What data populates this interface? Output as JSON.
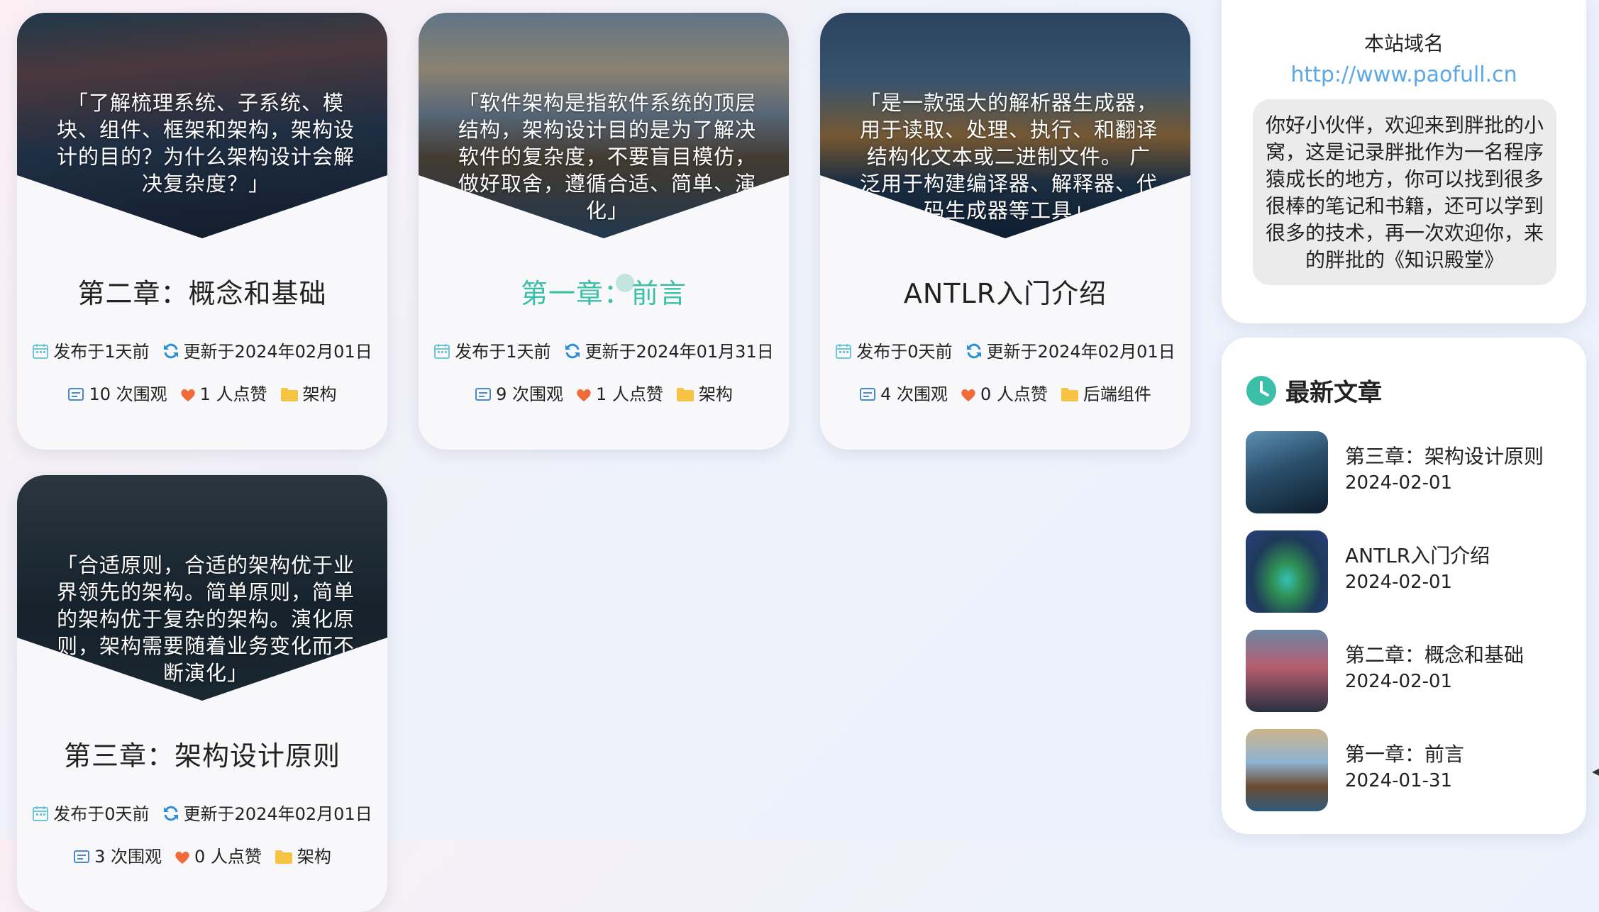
{
  "cards": [
    {
      "quote": "「了解梳理系统、子系统、模块、组件、框架和架构，架构设计的目的？为什么架构设计会解决复杂度？」",
      "title": "第二章：概念和基础",
      "published": "发布于1天前",
      "updated": "更新于2024年02月01日",
      "views": "10 次围观",
      "likes": "1 人点赞",
      "category": "架构"
    },
    {
      "quote": "「软件架构是指软件系统的顶层结构，架构设计目的是为了解决软件的复杂度，不要盲目模仿，做好取舍，遵循合适、简单、演化」",
      "title": "第一章：前言",
      "published": "发布于1天前",
      "updated": "更新于2024年01月31日",
      "views": "9 次围观",
      "likes": "1 人点赞",
      "category": "架构"
    },
    {
      "quote": "「是一款强大的解析器生成器，用于读取、处理、执行、和翻译结构化文本或二进制文件。 广泛用于构建编译器、解释器、代码生成器等工具」",
      "title": "ANTLR入门介绍",
      "published": "发布于0天前",
      "updated": "更新于2024年02月01日",
      "views": "4 次围观",
      "likes": "0 人点赞",
      "category": "后端组件"
    },
    {
      "quote": "「合适原则，合适的架构优于业界领先的架构。简单原则，简单的架构优于复杂的架构。演化原则，架构需要随着业务变化而不断演化」",
      "title": "第三章：架构设计原则",
      "published": "发布于0天前",
      "updated": "更新于2024年02月01日",
      "views": "3 次围观",
      "likes": "0 人点赞",
      "category": "架构"
    }
  ],
  "sidebar": {
    "site_label": "本站域名",
    "site_url": "http://www.paofull.cn",
    "welcome": "你好小伙伴，欢迎来到胖批的小窝，这是记录胖批作为一名程序猿成长的地方，你可以找到很多很棒的笔记和书籍，还可以学到很多的技术，再一次欢迎你，来的胖批的《知识殿堂》",
    "latest_title": "最新文章",
    "latest": [
      {
        "title": "第三章：架构设计原则",
        "date": "2024-02-01"
      },
      {
        "title": "ANTLR入门介绍",
        "date": "2024-02-01"
      },
      {
        "title": "第二章：概念和基础",
        "date": "2024-02-01"
      },
      {
        "title": "第一章：前言",
        "date": "2024-01-31"
      }
    ]
  },
  "colors": {
    "accent": "#3cbfa8",
    "link": "#5aa8e8",
    "heart": "#f06a3a",
    "folder": "#f6c344",
    "calendar": "#6fc6d6",
    "refresh": "#2a8fd6"
  },
  "icons": [
    "calendar-icon",
    "refresh-icon",
    "views-icon",
    "heart-icon",
    "folder-icon",
    "clock-icon"
  ]
}
